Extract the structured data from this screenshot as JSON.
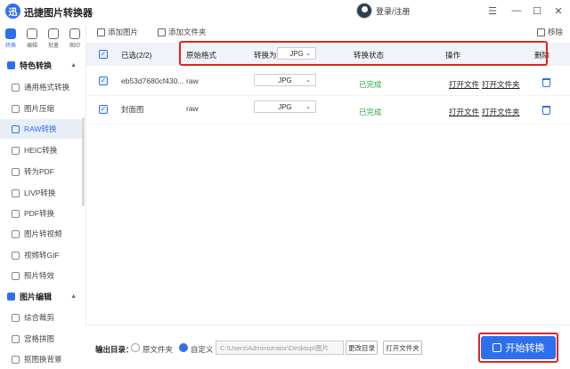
{
  "app": {
    "logo_char": "迅",
    "title": "迅捷图片转换器",
    "login_text": "登录/注册"
  },
  "window_controls": {
    "menu": "☰",
    "minimize": "—",
    "maximize": "☐",
    "close": "✕"
  },
  "nav_tabs": [
    {
      "label": "转换",
      "active": true
    },
    {
      "label": "编辑",
      "active": false
    },
    {
      "label": "批量",
      "active": false
    },
    {
      "label": "图印",
      "active": false
    }
  ],
  "sidebar": {
    "sections": [
      {
        "label": "特色转换",
        "items": [
          "通用格式转换",
          "图片压缩",
          "RAW转换",
          "HEIC转换",
          "转为PDF",
          "LIVP转换",
          "PDF转换",
          "图片转视频",
          "视频转GIF",
          "照片特效"
        ]
      },
      {
        "label": "图片编辑",
        "items": [
          "综合裁剪",
          "宫格拼图",
          "抠图换背景"
        ]
      }
    ],
    "active_item": "RAW转换"
  },
  "toolbar": {
    "add_image": "添加图片",
    "add_folder": "添加文件夹",
    "remove": "移除"
  },
  "table": {
    "selected_label": "已选(2/2)",
    "headers": {
      "format": "原始格式",
      "convert_to": "转换为",
      "status": "转换状态",
      "action": "操作",
      "delete": "删除"
    },
    "convert_to_value": "JPG",
    "rows": [
      {
        "name": "eb53d7680cf430...",
        "format": "raw",
        "target": "JPG",
        "status": "已完成",
        "open_file": "打开文件",
        "open_folder": "打开文件夹"
      },
      {
        "name": "封面图",
        "format": "raw",
        "target": "JPG",
        "status": "已完成",
        "open_file": "打开文件",
        "open_folder": "打开文件夹"
      }
    ]
  },
  "bottom": {
    "output_label": "输出目录：",
    "opt_source": "原文件夹",
    "opt_custom": "自定义",
    "path_value": "C:\\Users\\Administrator\\Desktop\\图片",
    "change_dir": "更改目录",
    "open_folder": "打开文件夹",
    "start": "开始转换"
  },
  "colors": {
    "accent": "#2f6fed",
    "success": "#2ca84c",
    "highlight": "#e02424"
  }
}
